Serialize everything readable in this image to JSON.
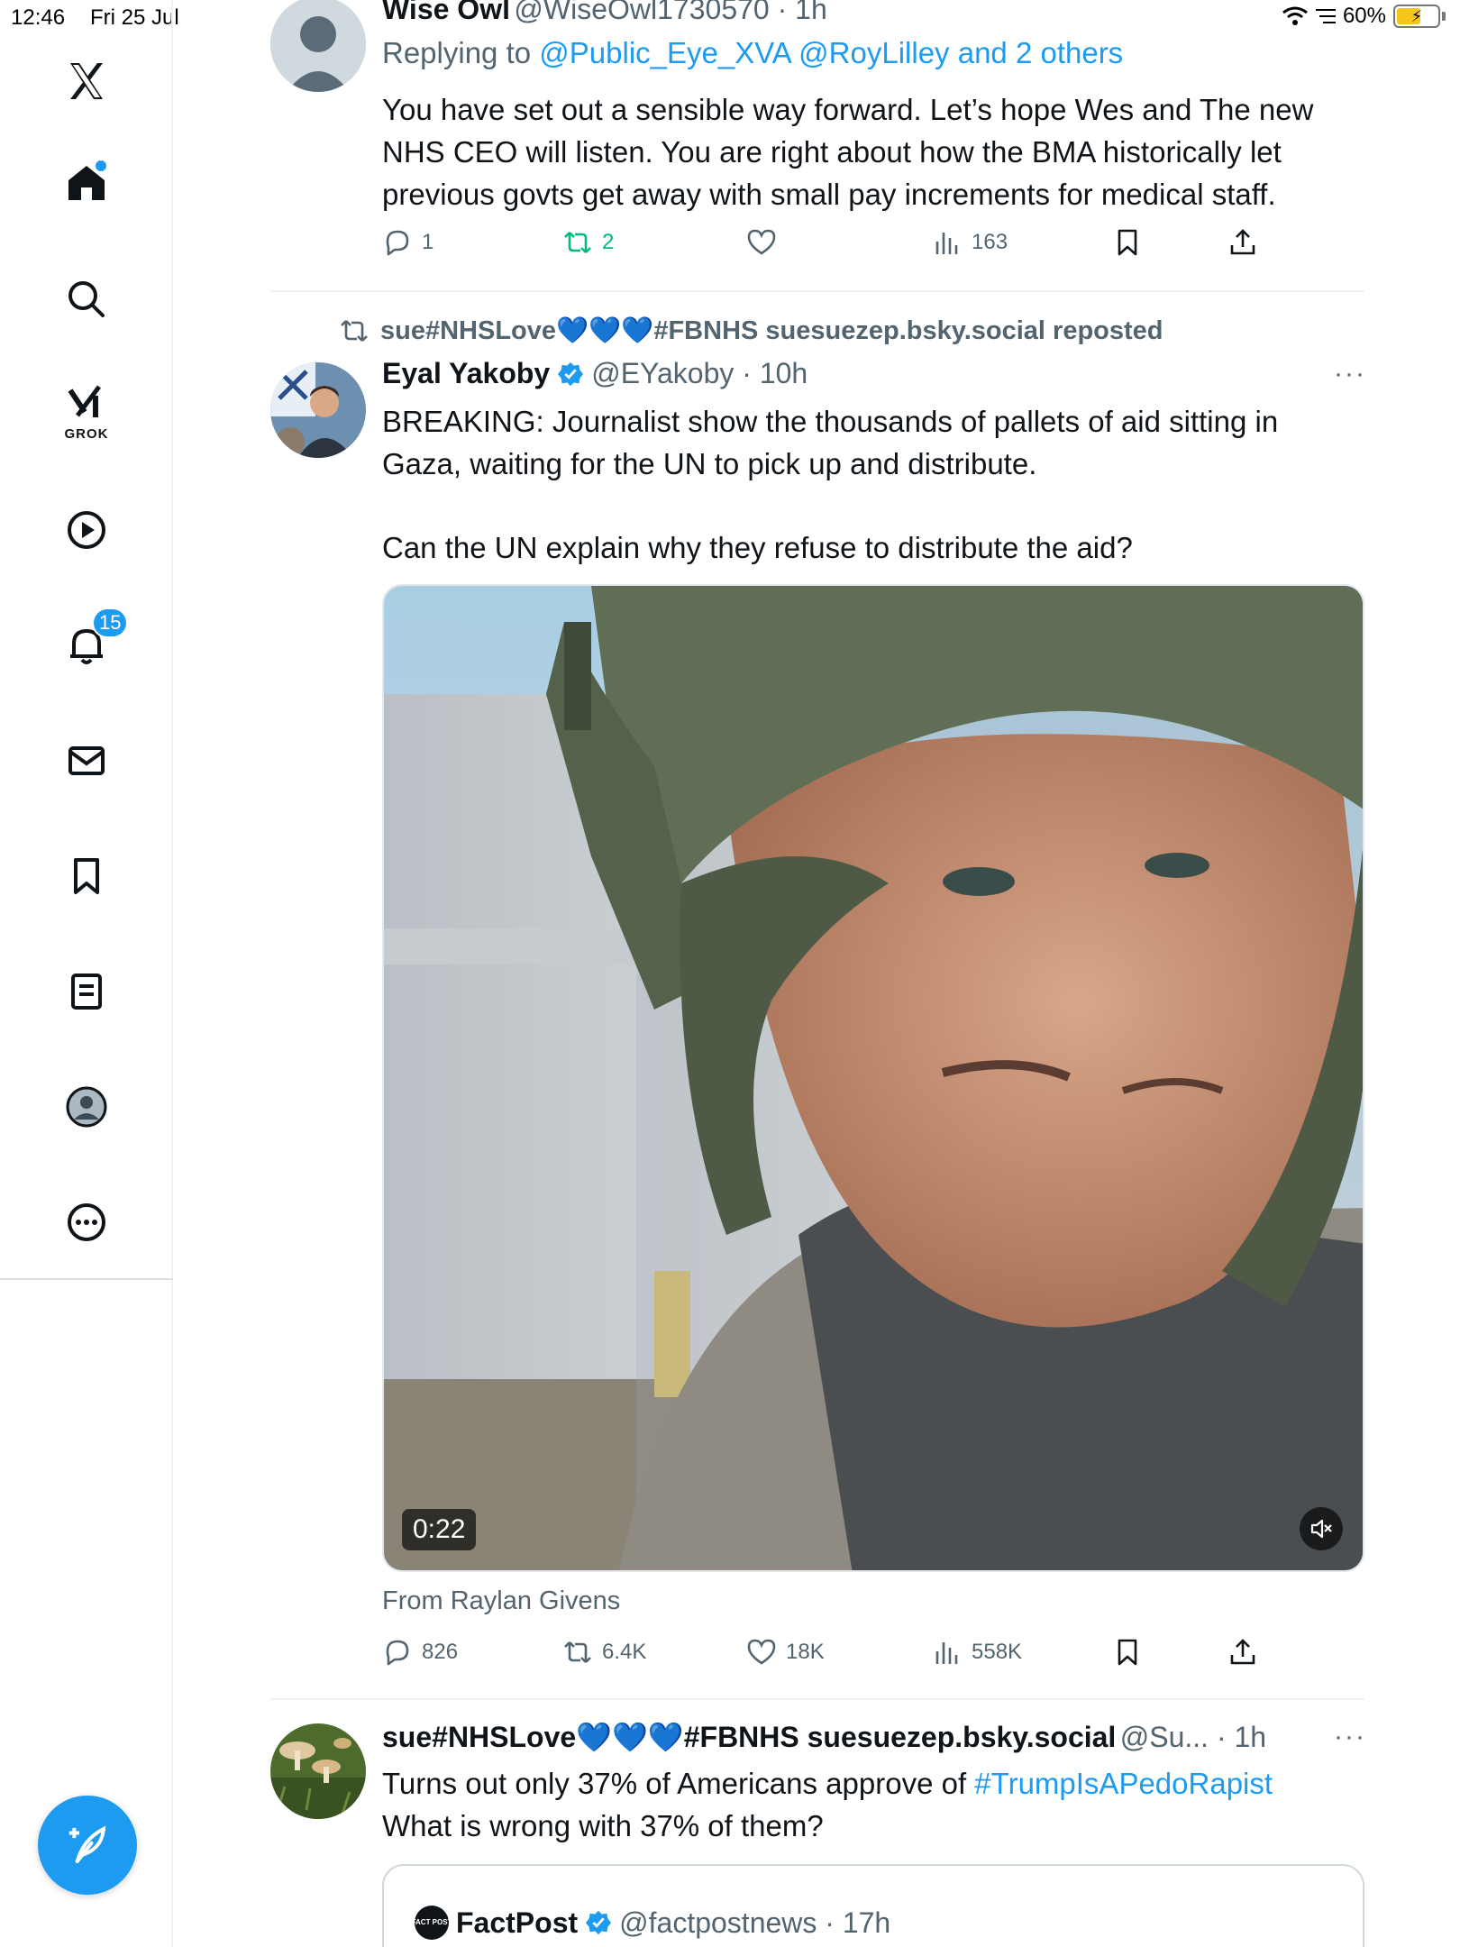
{
  "status_bar": {
    "time": "12:46",
    "date": "Fri 25 Jul",
    "battery": "60%",
    "battery_level": 0.6
  },
  "sidebar": {
    "notifications_badge": "15",
    "grok_label": "GROK"
  },
  "tweet1": {
    "name": "Wise Owl",
    "handle_time": "@WiseOwl1730570 · 1h",
    "replying_prefix": "Replying to",
    "replying_to": "@Public_Eye_XVA @RoyLilley and 2 others",
    "text": "You have set out a sensible way forward. Let’s hope Wes and The new NHS CEO will listen. You are right about how the BMA historically let previous govts get away with small pay increments  for medical staff.",
    "replies": "1",
    "reposts": "2",
    "likes": "",
    "views": "163"
  },
  "tweet2": {
    "repost_label": "sue#NHSLove💙💙💙#FBNHS suesuezep.bsky.social reposted",
    "name": "Eyal Yakoby",
    "handle_time": "@EYakoby · 10h",
    "text1": "BREAKING: Journalist show the thousands of pallets of aid sitting in Gaza, waiting for the UN to pick up and distribute.",
    "text2": "Can the UN explain why they refuse to distribute the aid?",
    "video_duration": "0:22",
    "from_label": "From Raylan Givens",
    "replies": "826",
    "reposts": "6.4K",
    "likes": "18K",
    "views": "558K"
  },
  "tweet3": {
    "name": "sue#NHSLove💙💙💙#FBNHS suesuezep.bsky.social",
    "handle_time": "@Su... · 1h",
    "text_prefix": "Turns out only 37% of Americans approve of ",
    "hashtag": "#TrumpIsAPedoRapist",
    "text2": "What is wrong with 37% of them?",
    "quote_name": "FactPost",
    "quote_handle_time": "@factpostnews · 17h",
    "quote_logo_text": "FACT POST"
  },
  "colors": {
    "accent": "#1d9bf0",
    "repost_green": "#00ba7c",
    "secondary_text": "#536471"
  }
}
